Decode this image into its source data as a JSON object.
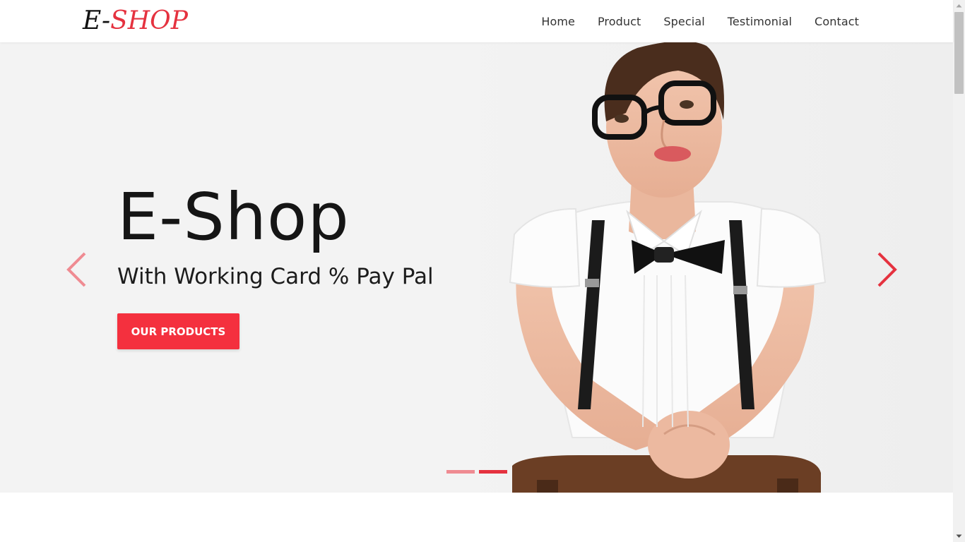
{
  "header": {
    "logo_prefix": "E-",
    "logo_suffix": "SHOP",
    "nav": [
      "Home",
      "Product",
      "Special",
      "Testimonial",
      "Contact"
    ]
  },
  "hero": {
    "title": "E-Shop",
    "subtitle": "With Working Card % Pay Pal",
    "button_label": "OUR PRODUCTS",
    "slides_total": 2,
    "active_slide": 2
  },
  "colors": {
    "accent": "#e5323f",
    "button": "#f4303e",
    "indicator_inactive": "#ef8b92",
    "hero_background": "#f3f3f3",
    "nav_text": "#333333"
  },
  "icons": {
    "prev": "chevron-left-icon",
    "next": "chevron-right-icon",
    "scroll_up": "triangle-up-icon",
    "scroll_down": "triangle-down-icon"
  }
}
